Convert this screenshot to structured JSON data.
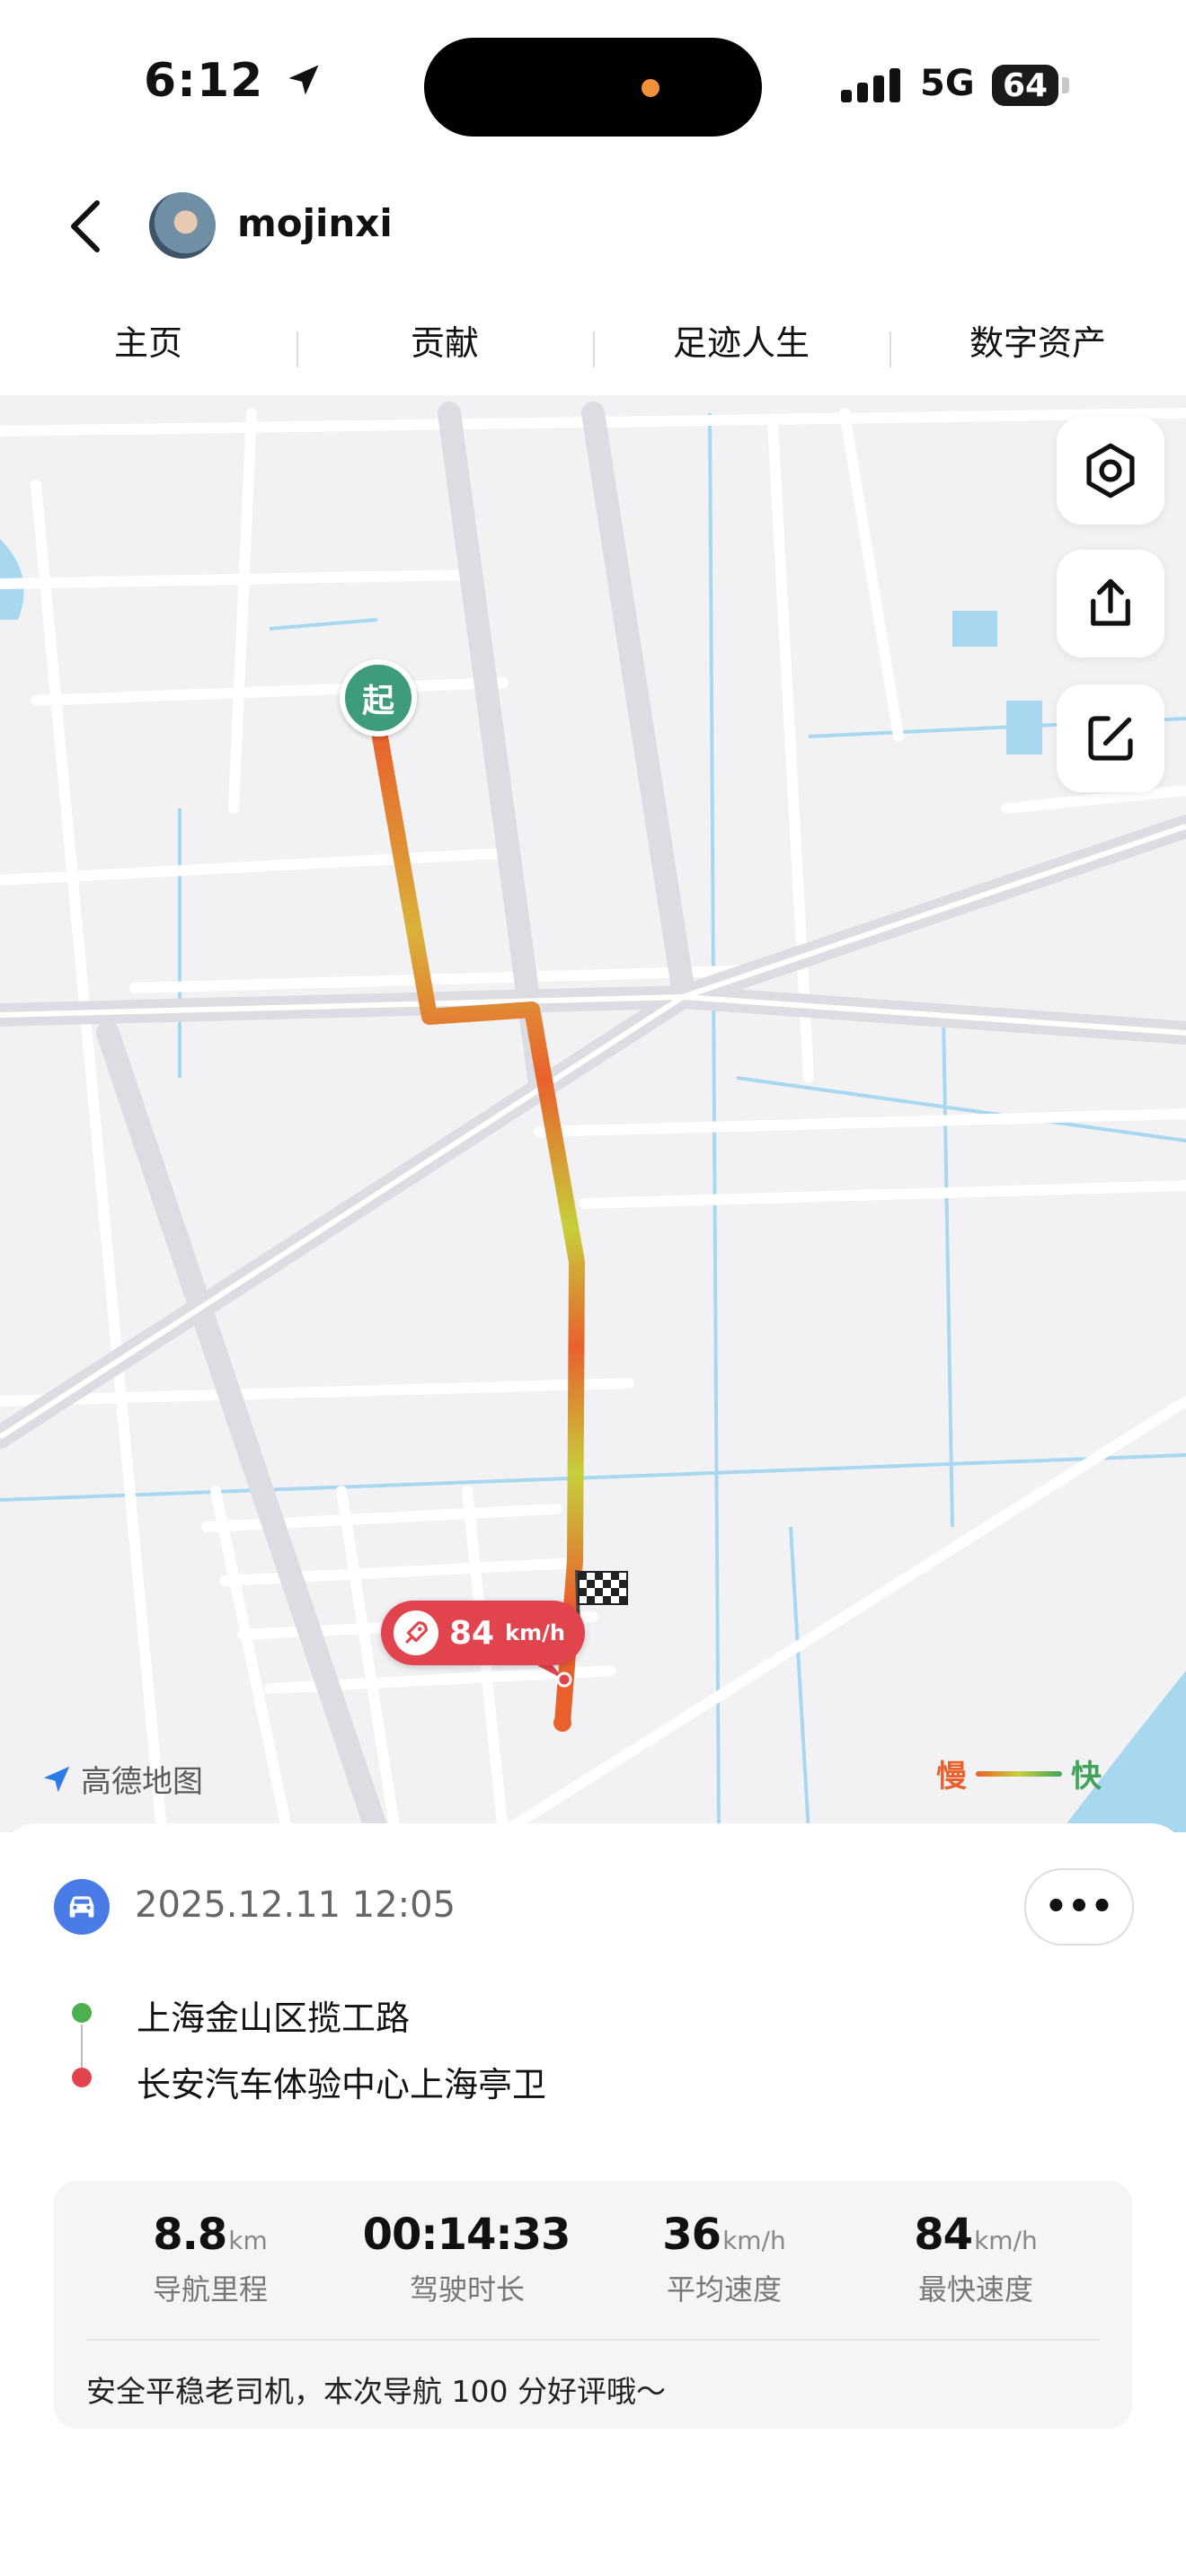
{
  "status_bar": {
    "time": "6:12",
    "network": "5G",
    "battery": "64"
  },
  "header": {
    "username": "mojinxi"
  },
  "tabs": [
    {
      "label": "主页"
    },
    {
      "label": "贡献"
    },
    {
      "label": "足迹人生"
    },
    {
      "label": "数字资产"
    }
  ],
  "map": {
    "start_label": "起",
    "max_speed_value": "84",
    "max_speed_unit": "km/h",
    "provider": "高德地图",
    "legend": {
      "slow": "慢",
      "fast": "快"
    },
    "colors": {
      "slow": "#e8612c",
      "fast": "#3fa45a",
      "route_mid": "#c6cf3b"
    }
  },
  "trip": {
    "datetime": "2025.12.11 12:05",
    "more_label": "•••",
    "start_place": "上海金山区揽工路",
    "end_place": "长安汽车体验中心上海亭卫",
    "stats": [
      {
        "value": "8.8",
        "unit": "km",
        "label": "导航里程"
      },
      {
        "value": "00:14:33",
        "unit": "",
        "label": "驾驶时长"
      },
      {
        "value": "36",
        "unit": "km/h",
        "label": "平均速度"
      },
      {
        "value": "84",
        "unit": "km/h",
        "label": "最快速度"
      }
    ],
    "comment": "安全平稳老司机，本次导航 100 分好评哦～"
  },
  "colors": {
    "accent_blue": "#4a7ce8",
    "start_green": "#3e9c7c",
    "end_red": "#e2444e"
  }
}
